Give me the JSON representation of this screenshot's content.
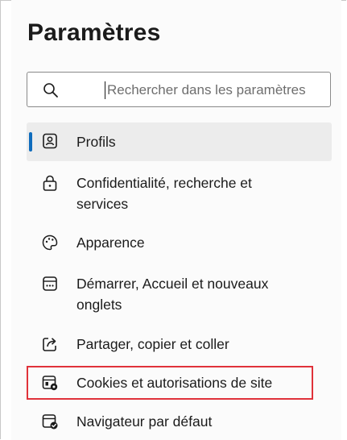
{
  "title": "Paramètres",
  "search": {
    "placeholder": "Rechercher dans les paramètres",
    "icon": "search-icon"
  },
  "nav": {
    "items": [
      {
        "label": "Profils",
        "icon": "profile-icon",
        "active": true
      },
      {
        "label": "Confidentialité, recherche et services",
        "icon": "lock-icon",
        "active": false
      },
      {
        "label": "Apparence",
        "icon": "palette-icon",
        "active": false
      },
      {
        "label": "Démarrer, Accueil et nouveaux onglets",
        "icon": "home-tab-icon",
        "active": false
      },
      {
        "label": "Partager, copier et coller",
        "icon": "share-icon",
        "active": false
      },
      {
        "label": "Cookies et autorisations de site",
        "icon": "site-permissions-icon",
        "active": false,
        "highlighted": true
      },
      {
        "label": "Navigateur par défaut",
        "icon": "default-browser-icon",
        "active": false
      }
    ]
  },
  "colors": {
    "accent": "#0f6cbd",
    "highlight_border": "#e0323a",
    "active_background": "#ececec"
  }
}
